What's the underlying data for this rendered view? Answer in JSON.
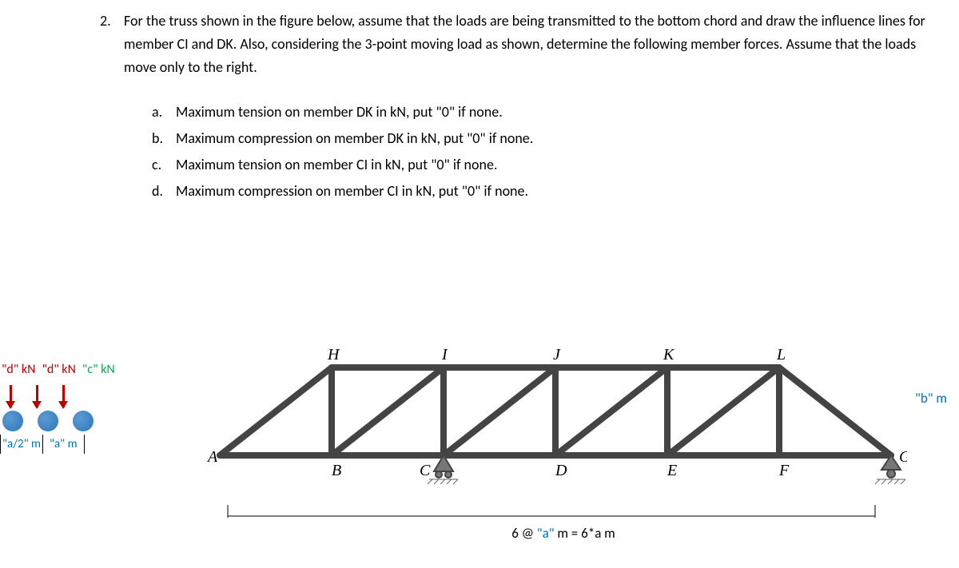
{
  "problem": {
    "number": "2.",
    "text": "For the truss shown in the figure below, assume that the loads are being transmitted to the bottom chord and draw the influence lines for member CI and DK. Also, considering the 3-point moving load as shown, determine the following member forces. Assume that the loads move only to the right.",
    "items": {
      "a": {
        "letter": "a.",
        "text": "Maximum tension on member DK in kN, put \"0\" if none."
      },
      "b": {
        "letter": "b.",
        "text": "Maximum compression on member DK in kN, put \"0\" if none."
      },
      "c": {
        "letter": "c.",
        "text": "Maximum tension on member CI in kN, put \"0\" if none."
      },
      "d": {
        "letter": "d.",
        "text": "Maximum compression on member CI in kN, put \"0\" if none."
      }
    }
  },
  "loads": {
    "l1": "\"d\" kN",
    "l2": "\"d\" kN",
    "l3": "\"c\" kN",
    "s1": "\"a/2\" m",
    "s2": "\"a\" m"
  },
  "truss": {
    "nodes": {
      "A": "A",
      "B": "B",
      "C": "C",
      "D": "D",
      "E": "E",
      "F": "F",
      "G": "G",
      "H": "H",
      "I": "I",
      "J": "J",
      "K": "K",
      "L": "L"
    },
    "height": "\"b\" m",
    "span_prefix": "6 @ ",
    "span_var": "\"a\"",
    "span_suffix": " m = 6*a m"
  }
}
